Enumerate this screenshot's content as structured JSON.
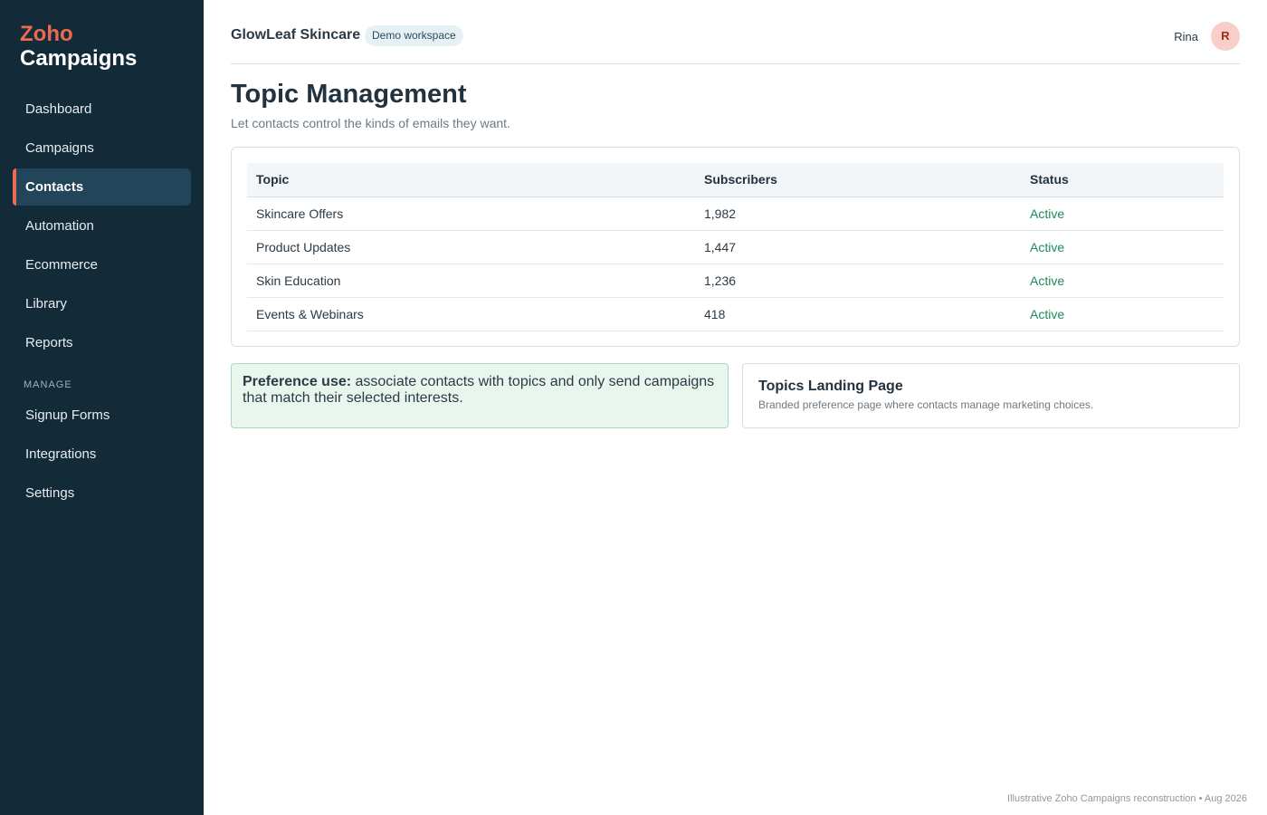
{
  "sidebar": {
    "logo_line1": "Zoho",
    "logo_line2": "Campaigns",
    "items": [
      {
        "label": "Dashboard"
      },
      {
        "label": "Campaigns"
      },
      {
        "label": "Contacts"
      },
      {
        "label": "Automation"
      },
      {
        "label": "Ecommerce"
      },
      {
        "label": "Library"
      },
      {
        "label": "Reports"
      }
    ],
    "section_label": "MANAGE",
    "manage_items": [
      {
        "label": "Signup Forms"
      },
      {
        "label": "Integrations"
      },
      {
        "label": "Settings"
      }
    ],
    "active_item": "Contacts"
  },
  "header": {
    "brand": "GlowLeaf Skincare",
    "badge": "Demo workspace",
    "user_name": "Rina",
    "avatar_initial": "R"
  },
  "main": {
    "title": "Topic Management",
    "subtitle": "Let contacts control the kinds of emails they want.",
    "table": {
      "columns": [
        "Topic",
        "Subscribers",
        "Status"
      ],
      "rows": [
        [
          "Skincare Offers",
          "1,982",
          "Active"
        ],
        [
          "Product Updates",
          "1,447",
          "Active"
        ],
        [
          "Skin Education",
          "1,236",
          "Active"
        ],
        [
          "Events & Webinars",
          "418",
          "Active"
        ]
      ]
    },
    "preference": {
      "label": "Preference use:",
      "text": " associate contacts with topics and only send campaigns that match their selected interests."
    },
    "landing": {
      "title": "Topics Landing Page",
      "description": "Branded preference page where contacts manage marketing choices."
    }
  },
  "footer": "Illustrative Zoho Campaigns reconstruction • Aug 2026",
  "colors": {
    "sidebar_bg": "#132a38",
    "accent": "#ec6a4f",
    "active_status": "#1e8a5a",
    "pref_bg": "#e8f6ee"
  }
}
